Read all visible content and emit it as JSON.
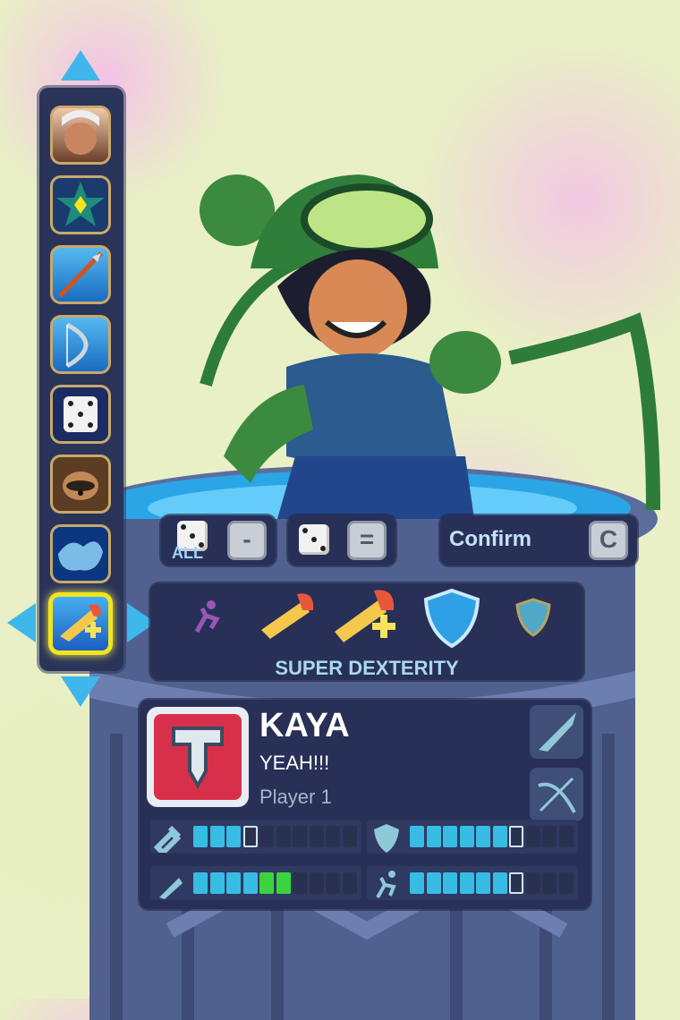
{
  "navigation": {
    "up_arrow": "arrow-up",
    "down_arrow": "arrow-down",
    "left_arrow": "arrow-left",
    "right_arrow": "arrow-right"
  },
  "loadout_slots": [
    {
      "icon": "character-portrait-icon",
      "selected": false
    },
    {
      "icon": "spiked-star-emblem-icon",
      "selected": false
    },
    {
      "icon": "spear-weapon-icon",
      "selected": false
    },
    {
      "icon": "bow-weapon-icon",
      "selected": false
    },
    {
      "icon": "random-dice-icon",
      "selected": false
    },
    {
      "icon": "raccoon-companion-icon",
      "selected": false
    },
    {
      "icon": "blue-splash-podium-icon",
      "selected": false
    },
    {
      "icon": "stance-icon",
      "selected": true
    }
  ],
  "actions": {
    "randomize_all_label": "ALL",
    "randomize_all_key": "-",
    "randomize_key": "=",
    "confirm_label": "Confirm",
    "confirm_key": "C"
  },
  "stance": {
    "name": "SUPER DEXTERITY",
    "options": [
      "speed-stance-icon",
      "dexterity-stance-icon",
      "super-dexterity-stance-icon",
      "defense-stance-icon",
      "super-defense-stance-icon"
    ],
    "selected_index": 2
  },
  "player_card": {
    "name": "KAYA",
    "taunt": "YEAH!!!",
    "player": "Player 1",
    "weapons": [
      "spear-icon",
      "bow-icon"
    ]
  },
  "stats": [
    {
      "icon": "strength-icon",
      "value": 4,
      "max": 10,
      "bonus": 0
    },
    {
      "icon": "defense-icon",
      "value": 7,
      "max": 10,
      "bonus": 0
    },
    {
      "icon": "dexterity-icon",
      "value": 4,
      "max": 10,
      "bonus": 2
    },
    {
      "icon": "speed-icon",
      "value": 7,
      "max": 10,
      "bonus": 0
    }
  ],
  "colors": {
    "panel": "#283058",
    "accent_yellow": "#f3e51d",
    "stat_fill": "#37bde3",
    "stat_bonus": "#3bd43f",
    "text_light": "#c2e2f5"
  }
}
